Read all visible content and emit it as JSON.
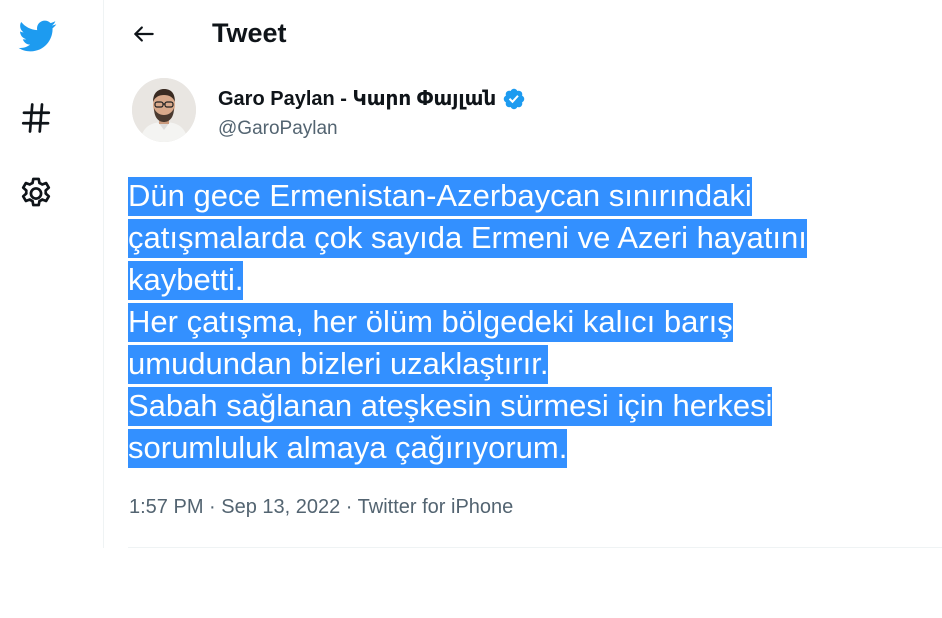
{
  "header": {
    "title": "Tweet"
  },
  "author": {
    "display_name": "Garo Paylan - Կարո Փայլան",
    "handle": "@GaroPaylan",
    "verified": true
  },
  "tweet": {
    "lines": [
      "Dün gece Ermenistan-Azerbaycan sınırındaki ",
      "çatışmalarda çok sayıda Ermeni ve Azeri hayatını ",
      "kaybetti. ",
      "Her çatışma, her ölüm bölgedeki kalıcı barış ",
      "umudundan bizleri uzaklaştırır. ",
      "Sabah sağlanan ateşkesin sürmesi için herkesi ",
      "sorumluluk almaya çağırıyorum."
    ],
    "meta": "1:57 PM · Sep 13, 2022 · Twitter for iPhone"
  },
  "colors": {
    "brand": "#1d9bf0",
    "selection": "#3390ff",
    "muted_text": "#536471"
  },
  "icons": {
    "logo": "twitter-bird-icon",
    "explore": "hashtag-icon",
    "settings": "gear-icon",
    "back": "arrow-left-icon",
    "verified": "verified-badge-icon"
  }
}
